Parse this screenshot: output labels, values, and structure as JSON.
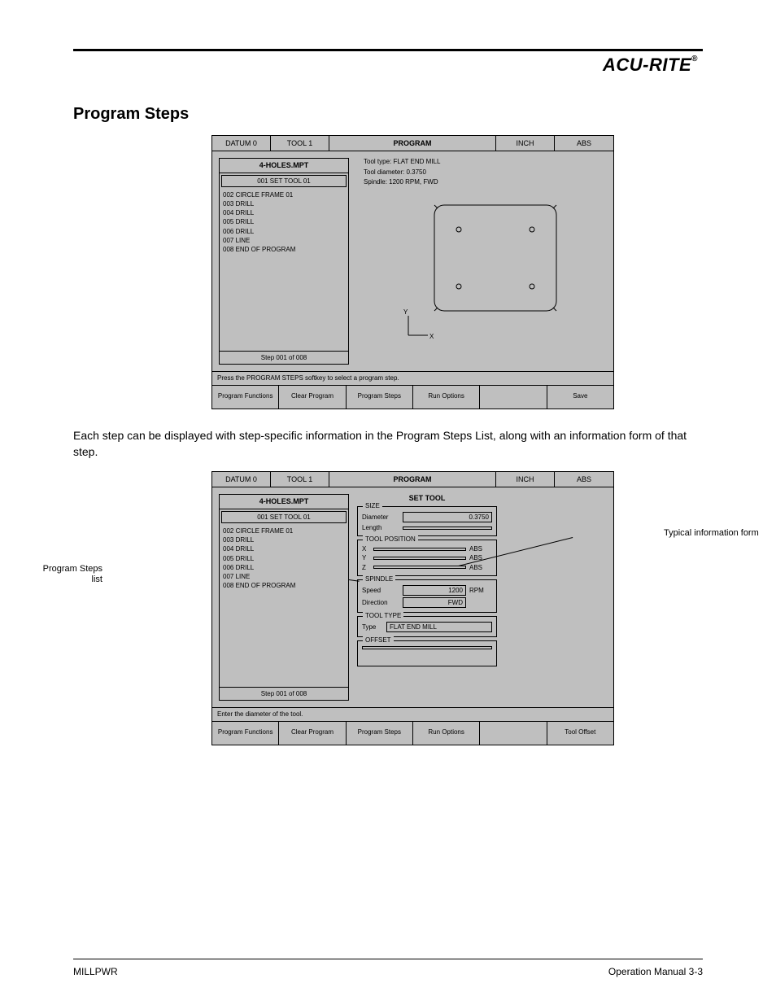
{
  "brand": "ACU-RITE",
  "brand_mark": "®",
  "section_title": "Program Steps",
  "screen1": {
    "top": {
      "a": "DATUM 0",
      "b": "TOOL 1",
      "c": "PROGRAM",
      "d": "INCH",
      "e": "ABS"
    },
    "panel": {
      "title": "4-HOLES.MPT",
      "selected": "001 SET TOOL 01",
      "items": [
        "002 CIRCLE FRAME 01",
        "003 DRILL",
        "004 DRILL",
        "005 DRILL",
        "006 DRILL",
        "007 LINE",
        "008 END OF PROGRAM"
      ],
      "foot": "Step 001 of 008"
    },
    "right_lines": [
      "Tool type: FLAT END MILL",
      "Tool diameter: 0.3750",
      "Spindle: 1200 RPM, FWD"
    ],
    "msg": "Press the PROGRAM STEPS softkey to select a program step.",
    "soft": [
      "Program Functions",
      "Clear Program",
      "Program Steps",
      "Run Options",
      "",
      "Save"
    ]
  },
  "para": "Each step can be displayed with step-specific information in the Program Steps List, along with an information form of that step.",
  "screen2": {
    "top": {
      "a": "DATUM 0",
      "b": "TOOL 1",
      "c": "PROGRAM",
      "d": "INCH",
      "e": "ABS"
    },
    "panel": {
      "title": "4-HOLES.MPT",
      "selected": "001 SET TOOL 01",
      "items": [
        "002 CIRCLE FRAME 01",
        "003 DRILL",
        "004 DRILL",
        "005 DRILL",
        "006 DRILL",
        "007 LINE",
        "008 END OF PROGRAM"
      ],
      "foot": "Step 001 of 008"
    },
    "form": {
      "title": "SET TOOL",
      "size": {
        "label": "SIZE",
        "diam_lab": "Diameter",
        "diam": "0.3750",
        "len_lab": "Length",
        "len": ""
      },
      "pos": {
        "label": "TOOL POSITION",
        "x": "X",
        "y": "Y",
        "z": "Z",
        "vx": "",
        "vy": "",
        "vz": "",
        "unit": "ABS"
      },
      "spd": {
        "label": "SPINDLE",
        "speed_lab": "Speed",
        "speed": "1200",
        "dir_lab": "Direction",
        "dir": "FWD",
        "unit": "RPM"
      },
      "type": {
        "label": "TOOL TYPE",
        "type_lab": "Type",
        "val": "FLAT END MILL"
      },
      "off": {
        "label": "OFFSET",
        "val": ""
      }
    },
    "msg": "Enter the diameter of the tool.",
    "soft": [
      "Program Functions",
      "Clear Program",
      "Program Steps",
      "Run Options",
      "",
      "Tool Offset"
    ]
  },
  "callouts": {
    "list": "Program Steps list",
    "form": "Typical information form"
  },
  "footer": {
    "left": "MILLPWR",
    "right": "Operation Manual   3-3"
  }
}
